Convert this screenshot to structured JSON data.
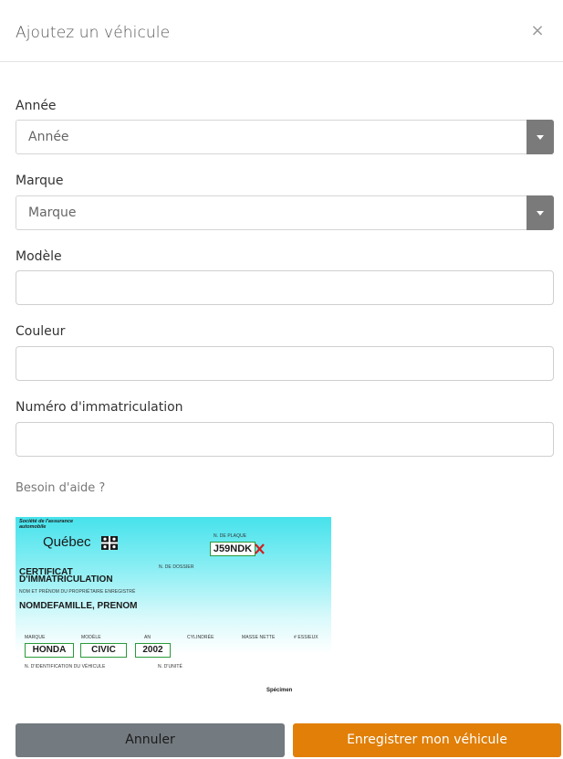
{
  "modal": {
    "title": "Ajoutez un véhicule",
    "close_symbol": "×"
  },
  "form": {
    "annee": {
      "label": "Année",
      "selected": "Année"
    },
    "marque": {
      "label": "Marque",
      "selected": "Marque"
    },
    "modele": {
      "label": "Modèle",
      "value": ""
    },
    "couleur": {
      "label": "Couleur",
      "value": ""
    },
    "immatriculation": {
      "label": "Numéro d'immatriculation",
      "value": ""
    }
  },
  "help": {
    "label": "Besoin d'aide ?"
  },
  "certificate": {
    "issuer_line1": "Société de l'assurance",
    "issuer_line2": "automobile",
    "province": "Québec",
    "plate_label": "N. DE PLAQUE",
    "plate_value": "J59NDK",
    "file_label": "N. DE DOSSIER",
    "title_line1": "CERTIFICAT",
    "title_line2": "D'IMMATRICULATION",
    "owner_label": "NOM ET PRÉNOM DU PROPRIÉTAIRE ENREGISTRÉ",
    "owner_value": "NOMDEFAMILLE, PRENOM",
    "col_marque": "MARQUE",
    "col_modele": "MODÈLE",
    "col_an": "AN",
    "col_cylindree": "CYLINDRÉE",
    "col_masse": "MASSE NETTE",
    "col_essieux": "# ESSIEUX",
    "marque_value": "HONDA",
    "modele_value": "CIVIC",
    "an_value": "2002",
    "vin_label": "N. D'IDENTIFICATION DU VÉHICULE",
    "unit_label": "N. D'UNITÉ",
    "specimen": "Spécimen"
  },
  "buttons": {
    "cancel": "Annuler",
    "save": "Enregistrer mon véhicule"
  },
  "colors": {
    "save_button": "#e17f08",
    "cancel_button": "#737a80",
    "select_arrow": "#7a7a7a",
    "certificate_cyan": "#46e2ec",
    "highlight_green": "#2a9a3a",
    "plate_mark_red": "#d21f1f"
  }
}
